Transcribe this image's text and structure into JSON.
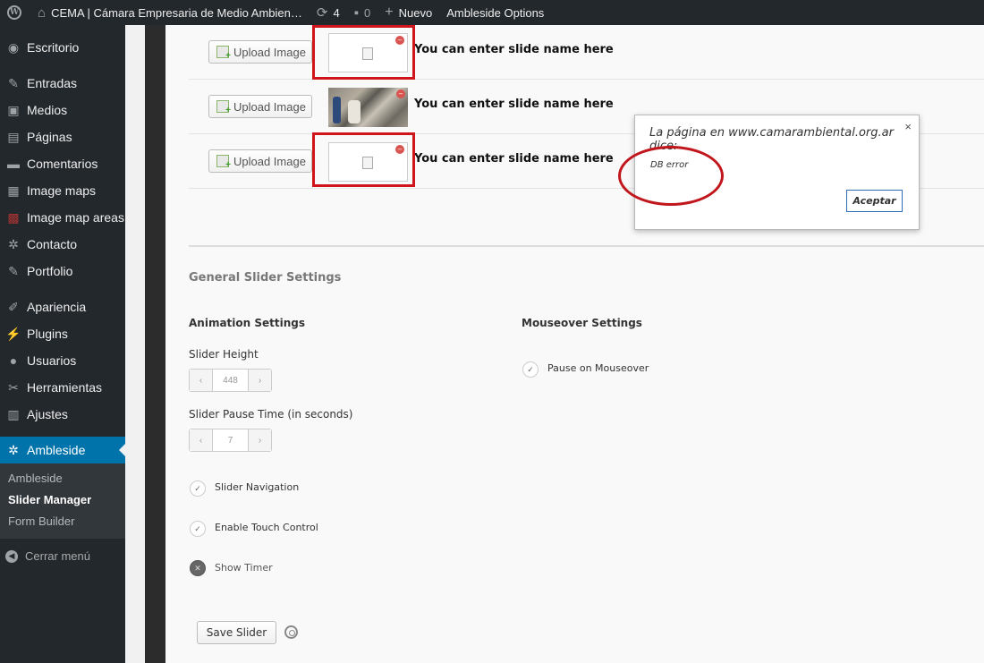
{
  "adminbar": {
    "site_name": "CEMA | Cámara Empresaria de Medio Ambien…",
    "updates_count": "4",
    "comments_count": "0",
    "new_label": "Nuevo",
    "options_label": "Ambleside Options",
    "icons": [
      "wordpress-logo",
      "home-icon",
      "refresh-icon",
      "comment-icon",
      "plus-icon"
    ]
  },
  "sidebar": {
    "items": [
      {
        "label": "Escritorio",
        "icon": "dashboard-icon"
      },
      {
        "label": "Entradas",
        "icon": "pin-icon"
      },
      {
        "label": "Medios",
        "icon": "media-icon"
      },
      {
        "label": "Páginas",
        "icon": "pages-icon"
      },
      {
        "label": "Comentarios",
        "icon": "comments-icon"
      },
      {
        "label": "Image maps",
        "icon": "image-maps-icon"
      },
      {
        "label": "Image map areas",
        "icon": "image-map-areas-icon"
      },
      {
        "label": "Contacto",
        "icon": "gear-icon"
      },
      {
        "label": "Portfolio",
        "icon": "pin-icon"
      },
      {
        "label": "Apariencia",
        "icon": "brush-icon"
      },
      {
        "label": "Plugins",
        "icon": "plug-icon"
      },
      {
        "label": "Usuarios",
        "icon": "user-icon"
      },
      {
        "label": "Herramientas",
        "icon": "wrench-icon"
      },
      {
        "label": "Ajustes",
        "icon": "settings-icon"
      },
      {
        "label": "Ambleside",
        "icon": "gear-icon"
      }
    ],
    "submenu": [
      "Ambleside",
      "Slider Manager",
      "Form Builder"
    ],
    "collapse_label": "Cerrar menú",
    "accent_color": "#0073aa"
  },
  "slides": [
    {
      "button": "Upload Image",
      "name": "You can enter slide name here",
      "image": "broken"
    },
    {
      "button": "Upload Image",
      "name": "You can enter slide name here",
      "image": "photo"
    },
    {
      "button": "Upload Image",
      "name": "You can enter slide name here",
      "image": "broken"
    }
  ],
  "settings": {
    "general_title": "General Slider Settings",
    "animation_title": "Animation Settings",
    "mouseover_title": "Mouseover Settings",
    "slider_height_label": "Slider Height",
    "slider_height_value": "448",
    "pause_time_label": "Slider Pause Time (in seconds)",
    "pause_time_value": "7",
    "slider_navigation_label": "Slider Navigation",
    "slider_navigation_checked": true,
    "touch_control_label": "Enable Touch Control",
    "touch_control_checked": true,
    "show_timer_label": "Show Timer",
    "show_timer_checked": false,
    "pause_mouseover_label": "Pause on Mouseover",
    "pause_mouseover_checked": true,
    "save_label": "Save Slider"
  },
  "dialog": {
    "title": "La página en www.camarambiental.org.ar dice:",
    "message": "DB error",
    "ok_label": "Aceptar",
    "close_glyph": "×"
  },
  "annotation_color": "#d0141b"
}
